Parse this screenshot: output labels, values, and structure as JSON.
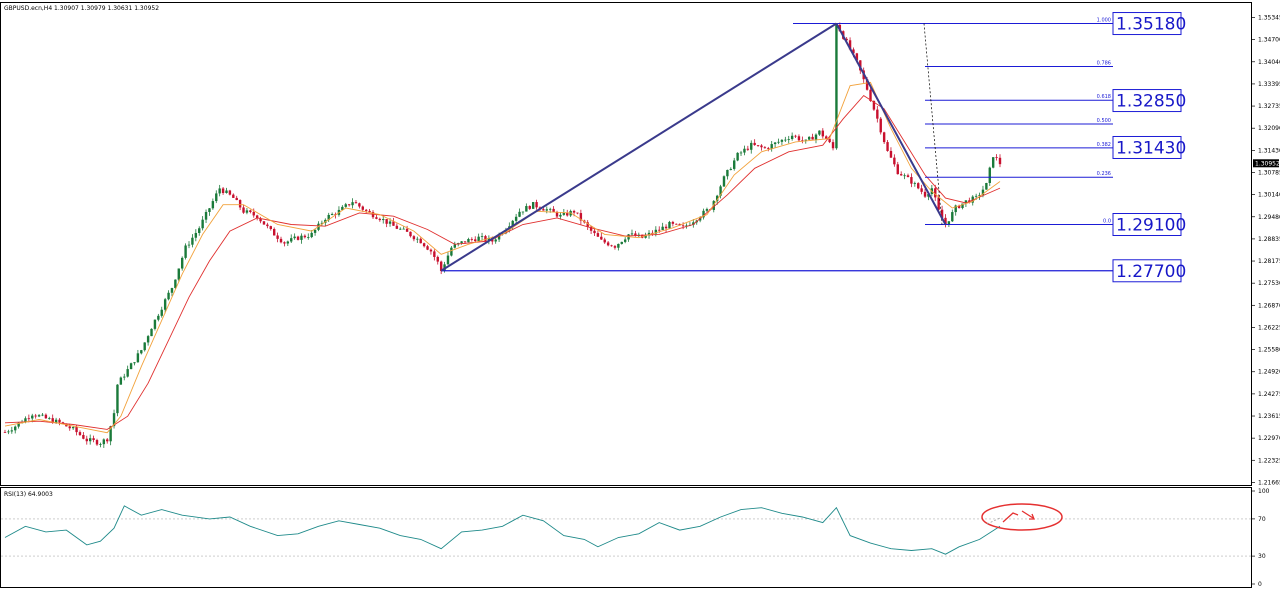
{
  "header": {
    "symbol_info": "GBPUSD.ecn,H4  1.30907 1.30979 1.30631 1.30952",
    "rsi_info": "RSI(13) 64.9003"
  },
  "colors": {
    "bull": "#1a7a3a",
    "bear": "#c8102e",
    "fib": "#1b1bd6",
    "trend": "#3a3a8c",
    "ma_fast": "#f2a23c",
    "ma_slow": "#e0302f",
    "rsi": "#1f8a8a",
    "circle": "#e53030",
    "bid_tag": "#000000"
  },
  "chart_data": {
    "type": "candlestick",
    "symbol": "GBPUSD.ecn",
    "timeframe": "H4",
    "price_axis": {
      "ylim": [
        1.2134,
        1.3565
      ],
      "ticks": [
        "1.35345",
        "1.34700",
        "1.34040",
        "1.33395",
        "1.32735",
        "1.32090",
        "1.31430",
        "1.30785",
        "1.30140",
        "1.29480",
        "1.28835",
        "1.28175",
        "1.27530",
        "1.26870",
        "1.26225",
        "1.25580",
        "1.24920",
        "1.24275",
        "1.23615",
        "1.22970",
        "1.22325",
        "1.21665"
      ],
      "current_price": "1.30952"
    },
    "price_path": [
      [
        0,
        1.2282
      ],
      [
        3,
        1.23
      ],
      [
        8,
        1.2338
      ],
      [
        12,
        1.2323
      ],
      [
        16,
        1.231
      ],
      [
        20,
        1.229
      ],
      [
        24,
        1.2258
      ],
      [
        28,
        1.225
      ],
      [
        30,
        1.2262
      ],
      [
        32,
        1.234
      ],
      [
        33,
        1.2426
      ],
      [
        36,
        1.247
      ],
      [
        40,
        1.253
      ],
      [
        43,
        1.26
      ],
      [
        46,
        1.266
      ],
      [
        49,
        1.272
      ],
      [
        53,
        1.284
      ],
      [
        57,
        1.29
      ],
      [
        60,
        1.296
      ],
      [
        63,
        1.302
      ],
      [
        67,
        1.299
      ],
      [
        70,
        1.295
      ],
      [
        74,
        1.2935
      ],
      [
        78,
        1.289
      ],
      [
        82,
        1.2855
      ],
      [
        86,
        1.287
      ],
      [
        90,
        1.288
      ],
      [
        94,
        1.293
      ],
      [
        98,
        1.295
      ],
      [
        102,
        1.298
      ],
      [
        106,
        1.295
      ],
      [
        110,
        1.293
      ],
      [
        114,
        1.2905
      ],
      [
        118,
        1.2885
      ],
      [
        122,
        1.286
      ],
      [
        125,
        1.283
      ],
      [
        127,
        1.2795
      ],
      [
        128,
        1.277
      ],
      [
        131,
        1.284
      ],
      [
        135,
        1.286
      ],
      [
        139,
        1.287
      ],
      [
        143,
        1.286
      ],
      [
        147,
        1.29
      ],
      [
        151,
        1.295
      ],
      [
        155,
        1.297
      ],
      [
        159,
        1.2955
      ],
      [
        163,
        1.2935
      ],
      [
        167,
        1.295
      ],
      [
        171,
        1.29
      ],
      [
        175,
        1.286
      ],
      [
        179,
        1.2845
      ],
      [
        183,
        1.288
      ],
      [
        187,
        1.287
      ],
      [
        191,
        1.289
      ],
      [
        195,
        1.291
      ],
      [
        199,
        1.29
      ],
      [
        203,
        1.293
      ],
      [
        207,
        1.296
      ],
      [
        211,
        1.305
      ],
      [
        215,
        1.312
      ],
      [
        219,
        1.315
      ],
      [
        223,
        1.314
      ],
      [
        227,
        1.316
      ],
      [
        231,
        1.318
      ],
      [
        235,
        1.316
      ],
      [
        239,
        1.319
      ],
      [
        241,
        1.317
      ],
      [
        243,
        1.314
      ],
      [
        244,
        1.3518
      ],
      [
        247,
        1.346
      ],
      [
        250,
        1.34
      ],
      [
        253,
        1.332
      ],
      [
        256,
        1.323
      ],
      [
        259,
        1.313
      ],
      [
        262,
        1.307
      ],
      [
        266,
        1.304
      ],
      [
        270,
        1.3
      ],
      [
        272,
        1.302
      ],
      [
        274,
        1.295
      ],
      [
        276,
        1.291
      ],
      [
        279,
        1.296
      ],
      [
        282,
        1.298
      ],
      [
        285,
        1.299
      ],
      [
        288,
        1.303
      ],
      [
        290,
        1.312
      ],
      [
        292,
        1.3095
      ]
    ],
    "ma_fast_path": [
      [
        0,
        1.23
      ],
      [
        10,
        1.232
      ],
      [
        20,
        1.23
      ],
      [
        30,
        1.228
      ],
      [
        34,
        1.233
      ],
      [
        40,
        1.248
      ],
      [
        46,
        1.262
      ],
      [
        52,
        1.276
      ],
      [
        58,
        1.288
      ],
      [
        64,
        1.297
      ],
      [
        70,
        1.297
      ],
      [
        80,
        1.291
      ],
      [
        90,
        1.289
      ],
      [
        100,
        1.296
      ],
      [
        110,
        1.294
      ],
      [
        120,
        1.289
      ],
      [
        128,
        1.282
      ],
      [
        136,
        1.285
      ],
      [
        146,
        1.288
      ],
      [
        156,
        1.295
      ],
      [
        166,
        1.2945
      ],
      [
        176,
        1.288
      ],
      [
        186,
        1.287
      ],
      [
        196,
        1.29
      ],
      [
        206,
        1.294
      ],
      [
        214,
        1.306
      ],
      [
        222,
        1.313
      ],
      [
        232,
        1.316
      ],
      [
        242,
        1.317
      ],
      [
        248,
        1.333
      ],
      [
        254,
        1.334
      ],
      [
        260,
        1.32
      ],
      [
        266,
        1.308
      ],
      [
        272,
        1.301
      ],
      [
        278,
        1.296
      ],
      [
        284,
        1.298
      ],
      [
        292,
        1.304
      ]
    ],
    "ma_slow_path": [
      [
        0,
        1.231
      ],
      [
        10,
        1.2315
      ],
      [
        20,
        1.2305
      ],
      [
        30,
        1.229
      ],
      [
        36,
        1.233
      ],
      [
        42,
        1.243
      ],
      [
        48,
        1.256
      ],
      [
        54,
        1.269
      ],
      [
        60,
        1.28
      ],
      [
        66,
        1.289
      ],
      [
        74,
        1.293
      ],
      [
        84,
        1.291
      ],
      [
        94,
        1.2905
      ],
      [
        104,
        1.2945
      ],
      [
        114,
        1.2935
      ],
      [
        124,
        1.2895
      ],
      [
        132,
        1.285
      ],
      [
        142,
        1.286
      ],
      [
        152,
        1.291
      ],
      [
        162,
        1.293
      ],
      [
        172,
        1.29
      ],
      [
        182,
        1.2875
      ],
      [
        192,
        1.288
      ],
      [
        202,
        1.291
      ],
      [
        212,
        1.3
      ],
      [
        220,
        1.308
      ],
      [
        230,
        1.313
      ],
      [
        240,
        1.315
      ],
      [
        246,
        1.323
      ],
      [
        252,
        1.33
      ],
      [
        258,
        1.326
      ],
      [
        264,
        1.316
      ],
      [
        270,
        1.306
      ],
      [
        276,
        1.299
      ],
      [
        282,
        1.2975
      ],
      [
        292,
        1.302
      ]
    ],
    "trendlines": [
      {
        "from": [
          128,
          1.277
        ],
        "to": [
          244,
          1.3518
        ]
      },
      {
        "from": [
          244,
          1.3518
        ],
        "to": [
          276,
          1.291
        ]
      }
    ],
    "fibonacci": {
      "levels": [
        {
          "ratio": "1.000",
          "price": 1.3518
        },
        {
          "ratio": "0.786",
          "price": 1.3388
        },
        {
          "ratio": "0.618",
          "price": 1.3286
        },
        {
          "ratio": "0.500",
          "price": 1.3214
        },
        {
          "ratio": "0.382",
          "price": 1.3142
        },
        {
          "ratio": "0.236",
          "price": 1.3053
        },
        {
          "ratio": "0.0",
          "price": 1.291
        }
      ]
    },
    "support_line": {
      "price": 1.277
    },
    "key_levels": [
      "1.35180",
      "1.32850",
      "1.31430",
      "1.29100",
      "1.27700"
    ],
    "rsi": {
      "period": 13,
      "value": 64.9003,
      "levels": [
        30,
        70
      ],
      "ylim": [
        0,
        100
      ],
      "ticks": [
        "100",
        "70",
        "30",
        "0"
      ],
      "path": [
        [
          0,
          50
        ],
        [
          6,
          62
        ],
        [
          12,
          56
        ],
        [
          18,
          58
        ],
        [
          24,
          42
        ],
        [
          28,
          46
        ],
        [
          32,
          60
        ],
        [
          35,
          84
        ],
        [
          40,
          74
        ],
        [
          46,
          80
        ],
        [
          52,
          74
        ],
        [
          60,
          70
        ],
        [
          66,
          72
        ],
        [
          72,
          62
        ],
        [
          80,
          52
        ],
        [
          86,
          54
        ],
        [
          92,
          62
        ],
        [
          98,
          68
        ],
        [
          104,
          64
        ],
        [
          110,
          60
        ],
        [
          116,
          52
        ],
        [
          122,
          48
        ],
        [
          128,
          38
        ],
        [
          134,
          56
        ],
        [
          140,
          58
        ],
        [
          146,
          62
        ],
        [
          152,
          74
        ],
        [
          158,
          68
        ],
        [
          164,
          52
        ],
        [
          170,
          48
        ],
        [
          174,
          40
        ],
        [
          180,
          50
        ],
        [
          186,
          54
        ],
        [
          192,
          66
        ],
        [
          198,
          58
        ],
        [
          204,
          62
        ],
        [
          210,
          72
        ],
        [
          216,
          80
        ],
        [
          222,
          82
        ],
        [
          228,
          76
        ],
        [
          234,
          72
        ],
        [
          240,
          66
        ],
        [
          244,
          82
        ],
        [
          248,
          52
        ],
        [
          254,
          44
        ],
        [
          260,
          38
        ],
        [
          266,
          36
        ],
        [
          272,
          38
        ],
        [
          276,
          32
        ],
        [
          280,
          40
        ],
        [
          286,
          48
        ],
        [
          292,
          62
        ]
      ]
    },
    "annotation": {
      "type": "ellipse",
      "label": "rsi-upturn"
    }
  }
}
